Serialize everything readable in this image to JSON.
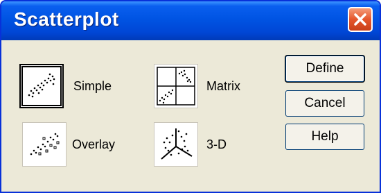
{
  "window": {
    "title": "Scatterplot"
  },
  "options": [
    {
      "label": "Simple",
      "icon": "simple-scatter-icon",
      "selected": true
    },
    {
      "label": "Matrix",
      "icon": "matrix-scatter-icon",
      "selected": false
    },
    {
      "label": "Overlay",
      "icon": "overlay-scatter-icon",
      "selected": false
    },
    {
      "label": "3-D",
      "icon": "3d-scatter-icon",
      "selected": false
    }
  ],
  "buttons": {
    "define": "Define",
    "cancel": "Cancel",
    "help": "Help"
  },
  "colors": {
    "titlebar": "#0054e3",
    "close": "#e5562c",
    "dialog_bg": "#ece9d8"
  }
}
